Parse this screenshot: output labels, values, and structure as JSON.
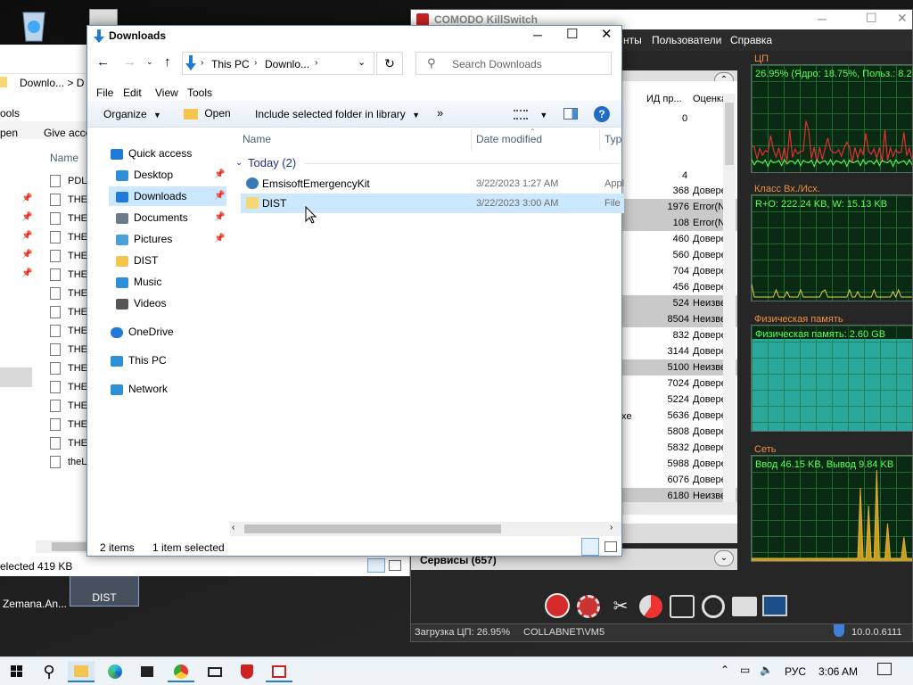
{
  "desktop": {
    "icons": [
      {
        "label": "Zemana.An..."
      },
      {
        "label": "DIST"
      }
    ]
  },
  "back_explorer": {
    "address": "Downlo... > D",
    "ribbon_tab": "ools",
    "cmd_open": "pen",
    "cmd_give": "Give acce",
    "col_name": "Name",
    "rows": [
      "PDL",
      "THE",
      "THE",
      "THE",
      "THE",
      "THE",
      "THE",
      "THE",
      "THE",
      "THE",
      "THE",
      "THE",
      "THE",
      "THE",
      "THE",
      "theL"
    ],
    "status": "elected  419 KB"
  },
  "killswitch": {
    "title": "COMODO KillSwitch",
    "menu": [
      "нты",
      "Пользователи",
      "Справка"
    ],
    "columns": {
      "pid": "ИД пр...",
      "rating": "Оценка"
    },
    "pid_top": [
      "0",
      "4"
    ],
    "rows": [
      {
        "pid": "368",
        "rating": "Доверен",
        "gray": false
      },
      {
        "pid": "1976",
        "rating": "Error(N",
        "gray": true
      },
      {
        "pid": "108",
        "rating": "Error(N",
        "gray": true
      },
      {
        "pid": "460",
        "rating": "Доверен",
        "gray": false
      },
      {
        "pid": "560",
        "rating": "Доверен",
        "gray": false
      },
      {
        "pid": "704",
        "rating": "Доверен",
        "gray": false
      },
      {
        "pid": "456",
        "rating": "Доверен",
        "gray": false
      },
      {
        "pid": "524",
        "rating": "Неизвес",
        "gray": true
      },
      {
        "pid": "8504",
        "rating": "Неизвес",
        "gray": true
      },
      {
        "pid": "832",
        "rating": "Доверен",
        "gray": false
      },
      {
        "pid": "3144",
        "rating": "Доверен",
        "gray": false
      },
      {
        "pid": "5100",
        "rating": "Неизвес",
        "gray": true
      },
      {
        "pid": "7024",
        "rating": "Доверен",
        "gray": false
      },
      {
        "pid": "5224",
        "rating": "Доверен",
        "gray": false
      },
      {
        "pid": "5636",
        "rating": "Доверен",
        "gray": false
      },
      {
        "pid": "5808",
        "rating": "Доверен",
        "gray": false
      },
      {
        "pid": "5832",
        "rating": "Доверен",
        "gray": false
      },
      {
        "pid": "5988",
        "rating": "Доверен",
        "gray": false
      },
      {
        "pid": "6076",
        "rating": "Доверен",
        "gray": false
      },
      {
        "pid": "6180",
        "rating": "Неизвес",
        "gray": true
      }
    ],
    "fragment_exe": "xe",
    "services": "Сервисы (657)",
    "graphs": {
      "cpu": {
        "caption": "ЦП",
        "label": "26.95% (Ядро: 18.75%, Польз.: 8.2"
      },
      "io": {
        "caption": "Класс Вх./Исх.",
        "label": "R+O: 222.24 KB, W: 15.13 KB"
      },
      "mem": {
        "caption": "Физическая память",
        "label": "Физическая память: 2.60 GB",
        "fill_pct": 87
      },
      "net": {
        "caption": "Сеть",
        "label": "Ввод 46.15 KB, Вывод 9.84 KB"
      }
    },
    "status": {
      "cpu": "Загрузка ЦП: 26.95%",
      "user": "COLLABNET\\VM5",
      "version": "10.0.0.6111"
    }
  },
  "explorer": {
    "title": "Downloads",
    "breadcrumb": [
      "This PC",
      "Downlo..."
    ],
    "search_placeholder": "Search Downloads",
    "menu": [
      "File",
      "Edit",
      "View",
      "Tools"
    ],
    "cmd": {
      "organize": "Organize",
      "open": "Open",
      "include": "Include selected folder in library",
      "more": "»"
    },
    "nav": [
      {
        "label": "Quick access",
        "icon": "star-icon"
      },
      {
        "label": "Desktop",
        "icon": "desktop-folder-icon",
        "pinned": true
      },
      {
        "label": "Downloads",
        "icon": "downloads-folder-icon",
        "pinned": true,
        "selected": true
      },
      {
        "label": "Documents",
        "icon": "documents-folder-icon",
        "pinned": true
      },
      {
        "label": "Pictures",
        "icon": "pictures-folder-icon",
        "pinned": true
      },
      {
        "label": "DIST",
        "icon": "folder-icon"
      },
      {
        "label": "Music",
        "icon": "music-icon"
      },
      {
        "label": "Videos",
        "icon": "videos-icon"
      },
      {
        "label": "OneDrive",
        "icon": "cloud-icon"
      },
      {
        "label": "This PC",
        "icon": "computer-icon"
      },
      {
        "label": "Network",
        "icon": "network-icon"
      }
    ],
    "columns": {
      "name": "Name",
      "date": "Date modified",
      "type": "Type"
    },
    "group": "Today (2)",
    "files": [
      {
        "name": "EmsisoftEmergencyKit",
        "date": "3/22/2023 1:27 AM",
        "type": "Appl"
      },
      {
        "name": "DIST",
        "date": "3/22/2023 3:00 AM",
        "type": "File",
        "selected": true
      }
    ],
    "status": {
      "count": "2 items",
      "selected": "1 item selected"
    }
  },
  "taskbar": {
    "language": "РУС",
    "time": "3:06 AM"
  }
}
